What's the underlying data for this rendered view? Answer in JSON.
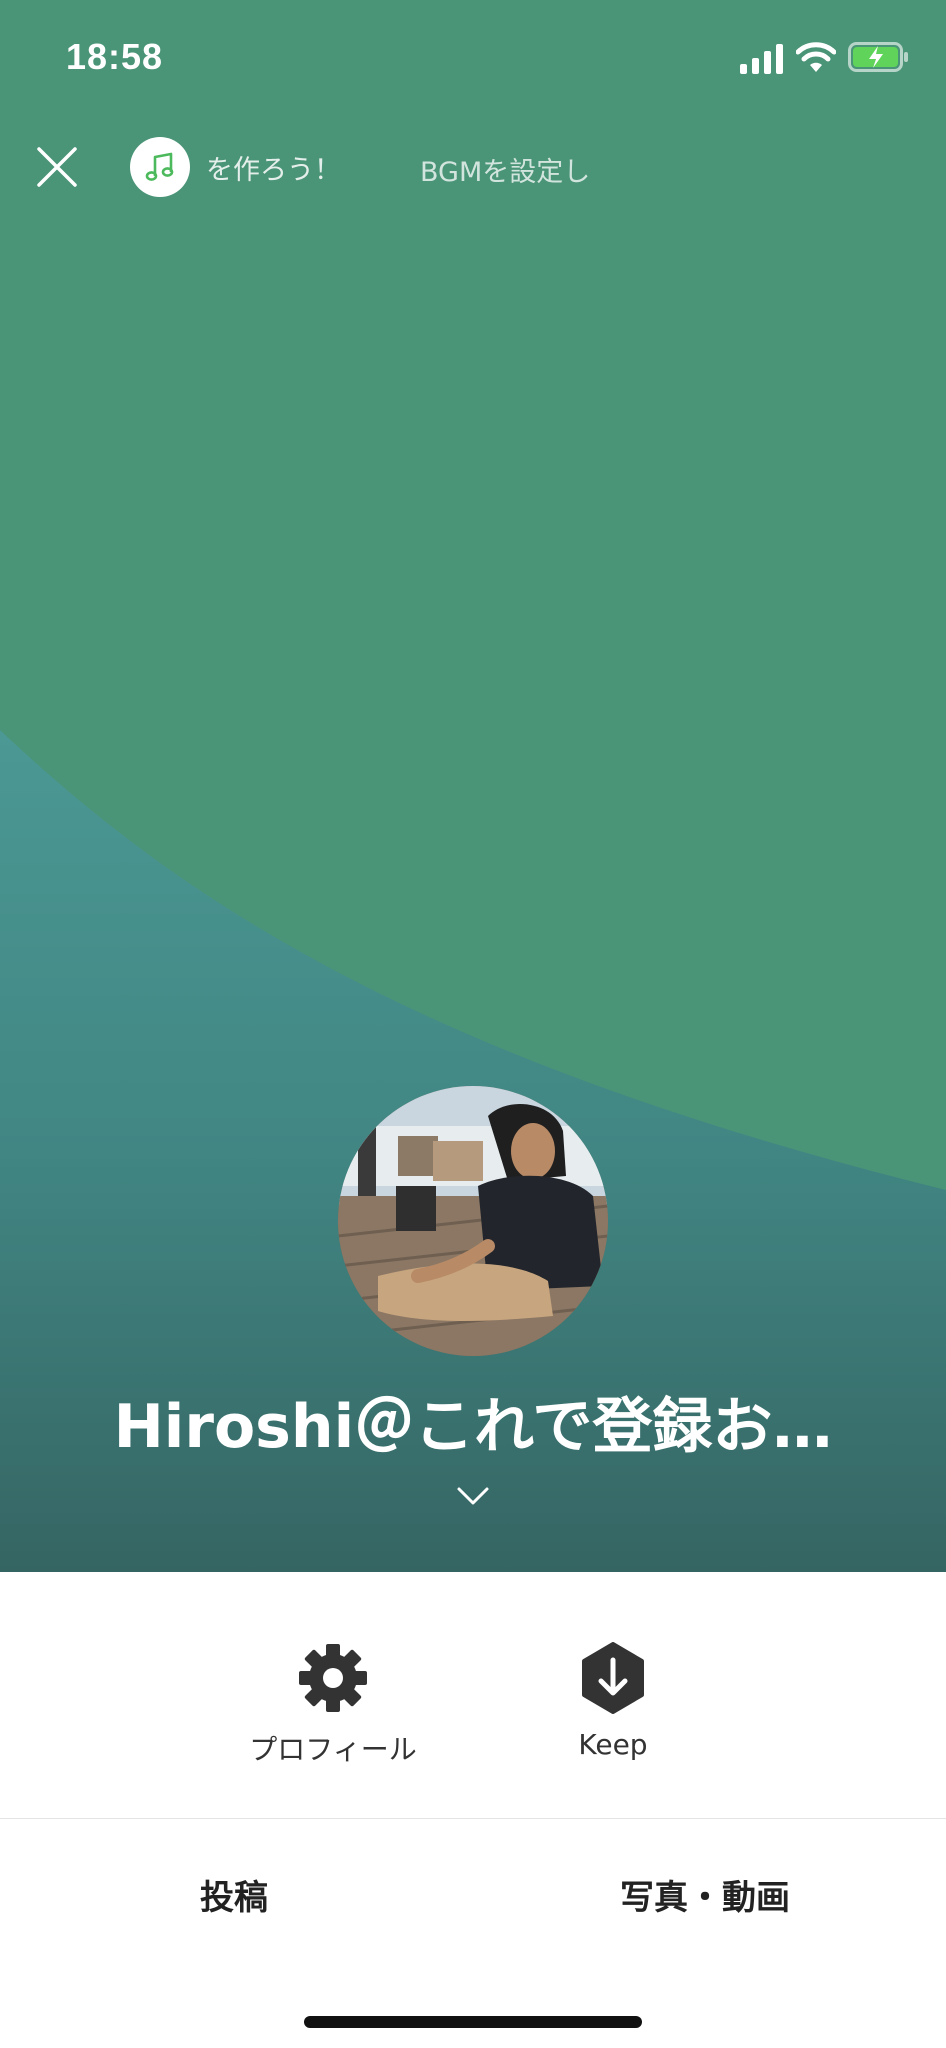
{
  "status_bar": {
    "time": "18:58",
    "icons": [
      "signal-icon",
      "wifi-icon",
      "battery-charging-icon"
    ]
  },
  "header": {
    "close_icon": "close-icon",
    "bgm_icon": "music-note-icon",
    "bgm_banner_text": "を作ろう！",
    "bgm_banner_text2": "BGMを設定し"
  },
  "profile": {
    "display_name": "Hiroshi＠これで登録お…",
    "expand_icon": "chevron-down-icon"
  },
  "actions": {
    "profile_label": "プロフィール",
    "profile_icon": "gear-icon",
    "keep_label": "Keep",
    "keep_icon": "keep-download-icon"
  },
  "tabs": [
    {
      "label": "投稿"
    },
    {
      "label": "写真・動画"
    }
  ],
  "colors": {
    "cover_green": "#4a9a84",
    "cover_teal": "#3f8480",
    "accent_green": "#4cba5c"
  }
}
